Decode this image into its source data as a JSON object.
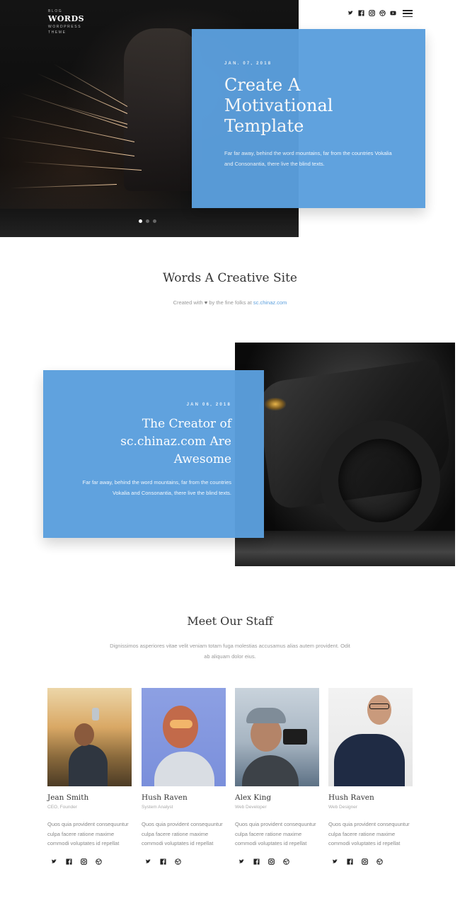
{
  "brand": {
    "top_text": "BLOG",
    "name": "WORDS",
    "tagline_1": "WORDPRESS",
    "tagline_2": "THEME"
  },
  "header": {
    "social_icons": [
      "twitter-icon",
      "facebook-icon",
      "instagram-icon",
      "dribbble-icon",
      "youtube-icon"
    ],
    "menu_icon": "hamburger-menu-icon"
  },
  "hero": {
    "date": "JAN. 07, 2018",
    "title": "Create A Motivational Template",
    "text": "Far far away, behind the word mountains, far from the countries Vokalia and Consonantia, there live the blind texts.",
    "slides": 3,
    "active_slide": 1
  },
  "intro": {
    "title": "Words A Creative Site",
    "credit_prefix": "Created with",
    "credit_middle": "by the fine folks at",
    "credit_link": "sc.chinaz.com"
  },
  "feature": {
    "date": "JAN 06, 2018",
    "title": "The Creator of sc.chinaz.com Are Awesome",
    "text": "Far far away, behind the word mountains, far from the countries Vokalia and Consonantia, there live the blind texts."
  },
  "staff": {
    "title": "Meet Our Staff",
    "description": "Dignissimos asperiores vitae velit veniam totam fuga molestias accusamus alias autem provident. Odit ab aliquam dolor eius.",
    "members": [
      {
        "name": "Jean Smith",
        "role": "CEO, Founder",
        "bio": "Quos quia provident consequuntur culpa facere ratione maxime commodi voluptates id repellat"
      },
      {
        "name": "Hush Raven",
        "role": "System Analyst",
        "bio": "Quos quia provident consequuntur culpa facere ratione maxime commodi voluptates id repellat"
      },
      {
        "name": "Alex King",
        "role": "Web Developer",
        "bio": "Quos quia provident consequuntur culpa facere ratione maxime commodi voluptates id repellat"
      },
      {
        "name": "Hush Raven",
        "role": "Web Designer",
        "bio": "Quos quia provident consequuntur culpa facere ratione maxime commodi voluptates id repellat"
      }
    ],
    "member_social_icons": [
      "twitter-icon",
      "facebook-icon",
      "instagram-icon",
      "dribbble-icon"
    ]
  },
  "colors": {
    "accent": "#5b9fdd",
    "text_dark": "#333333",
    "text_muted": "#999999"
  }
}
